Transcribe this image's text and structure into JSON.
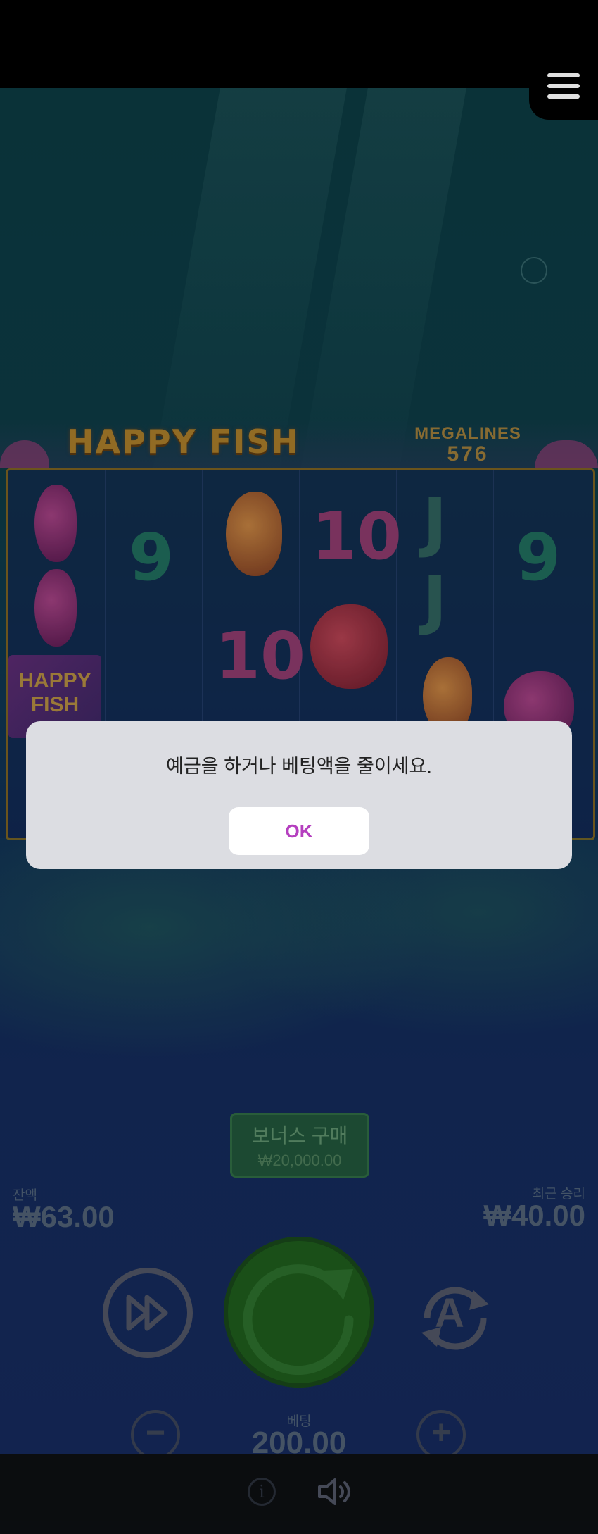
{
  "game": {
    "logo": "HAPPY FISH",
    "megalines_label": "MEGALINES",
    "megalines_value": "576",
    "tile_text_line1": "HAPPY",
    "tile_text_line2": "FISH"
  },
  "reels": {
    "symbols": [
      {
        "text": "9",
        "color": "#1f6a5a"
      },
      {
        "text": "10",
        "color": "#8a3a6a"
      },
      {
        "text": "J",
        "color": "#2e5f5a"
      },
      {
        "text": "9",
        "color": "#1f6a5a"
      },
      {
        "text": "J",
        "color": "#2e5f5a"
      },
      {
        "text": "10",
        "color": "#8a3a6a"
      }
    ]
  },
  "buy_bonus": {
    "label": "보너스 구매",
    "price": "₩20,000.00"
  },
  "balance": {
    "label": "잔액",
    "value": "₩63.00"
  },
  "last_win": {
    "label": "최근 승리",
    "value": "₩40.00"
  },
  "bet": {
    "label": "베팅",
    "value": "200.00",
    "minus": "−",
    "plus": "+"
  },
  "controls": {
    "info": "i",
    "autoplay_letter": "A"
  },
  "dialog": {
    "message": "예금을 하거나 베팅액을 줄이세요.",
    "ok_label": "OK"
  },
  "icons": {
    "menu": "hamburger-menu-icon",
    "turbo": "fast-forward-icon",
    "spin": "refresh-icon",
    "autoplay": "autoplay-icon",
    "info": "info-icon",
    "sound": "speaker-icon"
  },
  "colors": {
    "dialog_bg": "#dcdde2",
    "ok_text": "#b53fbf",
    "spin_green": "#1e5a1c"
  }
}
